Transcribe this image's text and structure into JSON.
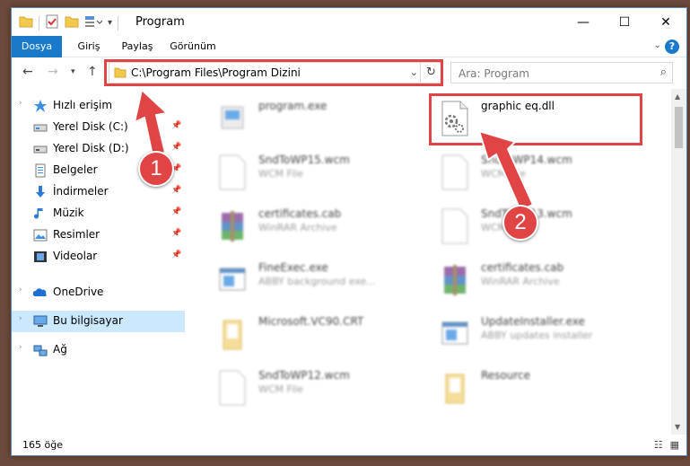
{
  "window": {
    "title": "Program"
  },
  "ribbon": {
    "tabs": [
      "Dosya",
      "Giriş",
      "Paylaş",
      "Görünüm"
    ]
  },
  "navbar": {
    "address": "C:\\Program Files\\Program Dizini",
    "search_placeholder": "Ara: Program"
  },
  "sidebar": {
    "items": [
      {
        "label": "Hızlı erişim",
        "icon": "star-icon"
      },
      {
        "label": "Yerel Disk (C:)",
        "icon": "disk-icon",
        "pinned": true
      },
      {
        "label": "Yerel Disk (D:)",
        "icon": "disk-icon",
        "pinned": true
      },
      {
        "label": "Belgeler",
        "icon": "documents-icon",
        "pinned": true
      },
      {
        "label": "İndirmeler",
        "icon": "downloads-icon",
        "pinned": true
      },
      {
        "label": "Müzik",
        "icon": "music-icon",
        "pinned": true
      },
      {
        "label": "Resimler",
        "icon": "pictures-icon",
        "pinned": true
      },
      {
        "label": "Videolar",
        "icon": "videos-icon",
        "pinned": true
      },
      {
        "label": "OneDrive",
        "icon": "onedrive-icon"
      },
      {
        "label": "Bu bilgisayar",
        "icon": "computer-icon",
        "selected": true
      },
      {
        "label": "Ağ",
        "icon": "network-icon"
      }
    ]
  },
  "files": [
    {
      "name": "program.exe",
      "type": "",
      "icon": "exe-icon"
    },
    {
      "name": "graphic eq.dll",
      "type": "",
      "icon": "dll-gear-icon"
    },
    {
      "name": "SndToWP15.wcm",
      "type": "WCM File",
      "icon": "blank-file-icon"
    },
    {
      "name": "SndToWP14.wcm",
      "type": "WCM File",
      "icon": "blank-file-icon"
    },
    {
      "name": "certificates.cab",
      "type": "WinRAR Archive",
      "icon": "winrar-icon"
    },
    {
      "name": "SndToWP13.wcm",
      "type": "WCM File",
      "icon": "blank-file-icon"
    },
    {
      "name": "FineExec.exe",
      "type": "ABBY background exe...",
      "icon": "app-window-icon"
    },
    {
      "name": "certificates.cab",
      "type": "WinRAR Archive",
      "icon": "winrar-icon"
    },
    {
      "name": "Microsoft.VC90.CRT",
      "type": "",
      "icon": "folder-icon"
    },
    {
      "name": "UpdateInstaller.exe",
      "type": "ABBY updates installer",
      "icon": "app-window-icon"
    },
    {
      "name": "SndToWP12.wcm",
      "type": "WCM File",
      "icon": "blank-file-icon"
    },
    {
      "name": "Resource",
      "type": "",
      "icon": "folder-icon"
    }
  ],
  "status": {
    "count": "165 öğe"
  },
  "annotations": {
    "badge1": "1",
    "badge2": "2",
    "color": "#e04444"
  }
}
